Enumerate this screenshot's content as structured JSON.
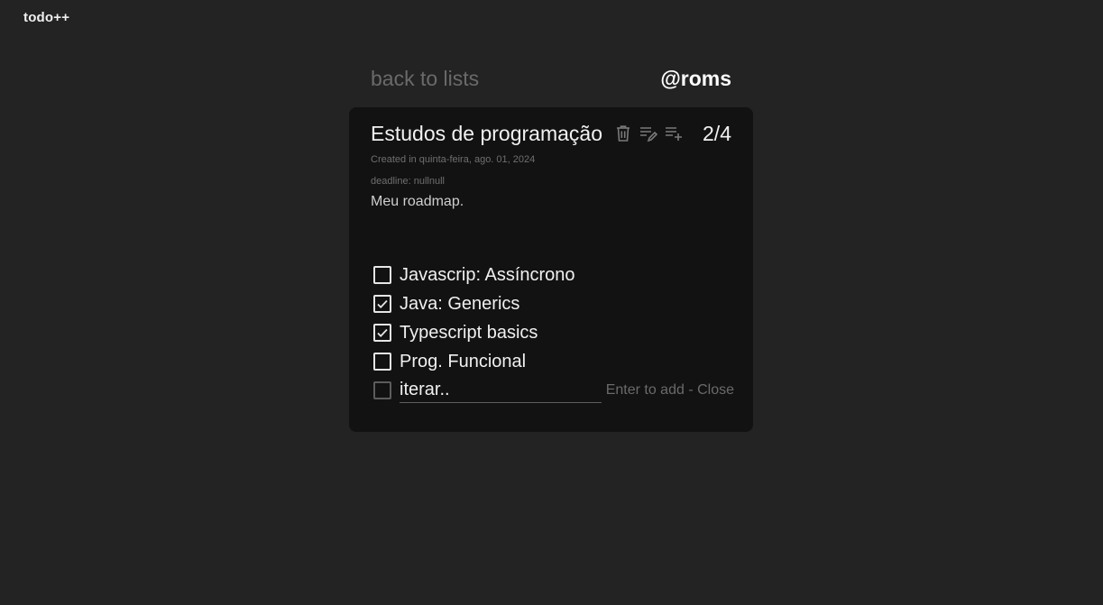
{
  "app": {
    "brand": "todo++"
  },
  "nav": {
    "back_label": "back to lists",
    "username": "@roms"
  },
  "list": {
    "title": "Estudos de programação",
    "progress": "2/4",
    "created": "Created in quinta-feira, ago. 01, 2024",
    "deadline": "deadline: nullnull",
    "description": "Meu roadmap.",
    "tools": [
      "trash-icon",
      "edit-list-icon",
      "add-list-icon"
    ],
    "tasks": [
      {
        "label": "Javascrip: Assíncrono",
        "done": false
      },
      {
        "label": "Java: Generics",
        "done": true
      },
      {
        "label": "Typescript basics",
        "done": true
      },
      {
        "label": "Prog. Funcional",
        "done": false
      }
    ],
    "new_task": {
      "value": "iterar..",
      "enter_hint": "Enter to add",
      "separator": " - ",
      "close_label": "Close"
    }
  },
  "colors": {
    "background": "#232323",
    "card": "#121212",
    "muted": "#6a6a6a",
    "text": "#f0f0f0"
  }
}
